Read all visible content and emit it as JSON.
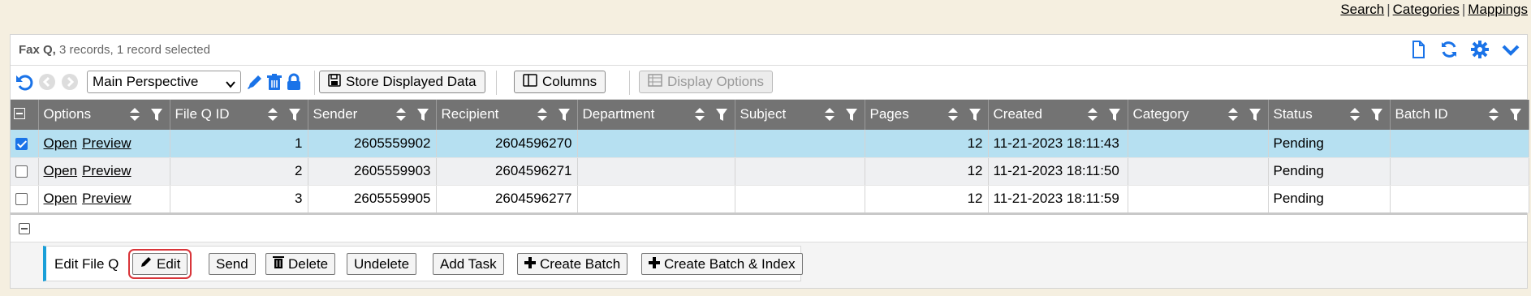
{
  "toplinks": {
    "search": "Search",
    "categories": "Categories",
    "mappings": "Mappings",
    "sep": "|"
  },
  "panel": {
    "title_bold": "Fax Q,",
    "title_rest": " 3 records, 1 record selected"
  },
  "toolbar": {
    "perspective_value": "Main Perspective",
    "store_label": "Store Displayed Data",
    "columns_label": "Columns",
    "display_options_label": "Display Options"
  },
  "grid": {
    "columns": [
      "Options",
      "File Q ID",
      "Sender",
      "Recipient",
      "Department",
      "Subject",
      "Pages",
      "Created",
      "Category",
      "Status",
      "Batch ID"
    ],
    "rows": [
      {
        "selected": true,
        "open": "Open",
        "preview": "Preview",
        "file_q_id": "1",
        "sender": "2605559902",
        "recipient": "2604596270",
        "department": "",
        "subject": "",
        "pages": "12",
        "created": "11-21-2023 18:11:43",
        "category": "",
        "status": "Pending",
        "batch_id": ""
      },
      {
        "selected": false,
        "open": "Open",
        "preview": "Preview",
        "file_q_id": "2",
        "sender": "2605559903",
        "recipient": "2604596271",
        "department": "",
        "subject": "",
        "pages": "12",
        "created": "11-21-2023 18:11:50",
        "category": "",
        "status": "Pending",
        "batch_id": ""
      },
      {
        "selected": false,
        "open": "Open",
        "preview": "Preview",
        "file_q_id": "3",
        "sender": "2605559905",
        "recipient": "2604596277",
        "department": "",
        "subject": "",
        "pages": "12",
        "created": "11-21-2023 18:11:59",
        "category": "",
        "status": "Pending",
        "batch_id": ""
      }
    ]
  },
  "actions": {
    "label": "Edit File Q",
    "edit": "Edit",
    "send": "Send",
    "delete": "Delete",
    "undelete": "Undelete",
    "add_task": "Add Task",
    "create_batch": "Create Batch",
    "create_batch_index": "Create Batch & Index"
  },
  "colors": {
    "accent": "#1a9fd8",
    "header_bg": "#737373",
    "selected_row": "#b6e0f1",
    "highlight": "#d9353a",
    "icon_blue": "#1a73e8"
  },
  "icons": [
    "undo-icon",
    "back-icon",
    "forward-icon",
    "pencil-icon",
    "trash-icon",
    "lock-icon",
    "floppy-icon",
    "columns-icon",
    "table-icon",
    "document-icon",
    "refresh-icon",
    "gear-icon",
    "chevron-down-icon",
    "sort-icon",
    "filter-icon",
    "plus-icon"
  ]
}
